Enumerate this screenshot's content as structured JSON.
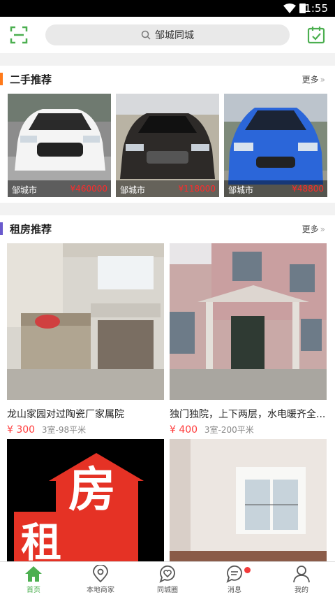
{
  "statusbar": {
    "time": "1:55"
  },
  "header": {
    "search_text": "邹城同城"
  },
  "colors": {
    "accent": "#4caf50",
    "orange": "#ff7a1a",
    "purple": "#6a5acd",
    "price": "#ff2a2a"
  },
  "secondhand": {
    "title": "二手推荐",
    "more": "更多",
    "items": [
      {
        "city": "邹城市",
        "price": "¥460000",
        "color": "white"
      },
      {
        "city": "邹城市",
        "price": "¥118000",
        "color": "black"
      },
      {
        "city": "邹城市",
        "price": "¥48800",
        "color": "blue"
      }
    ]
  },
  "rental": {
    "title": "租房推荐",
    "more": "更多",
    "items": [
      {
        "name": "龙山家园对过陶瓷厂家属院",
        "price": "¥ 300",
        "info": "3室-98平米"
      },
      {
        "name": "独门独院，上下两层，水电暖齐全...",
        "price": "¥ 400",
        "info": "3室-200平米"
      },
      {
        "name": "",
        "price": "",
        "info": "",
        "sign": "租房"
      },
      {
        "name": "",
        "price": "",
        "info": ""
      }
    ]
  },
  "tabs": [
    {
      "label": "首页",
      "icon": "home-icon"
    },
    {
      "label": "本地商家",
      "icon": "location-icon"
    },
    {
      "label": "同城圈",
      "icon": "heart-chat-icon"
    },
    {
      "label": "消息",
      "icon": "message-icon"
    },
    {
      "label": "我的",
      "icon": "person-icon"
    }
  ]
}
